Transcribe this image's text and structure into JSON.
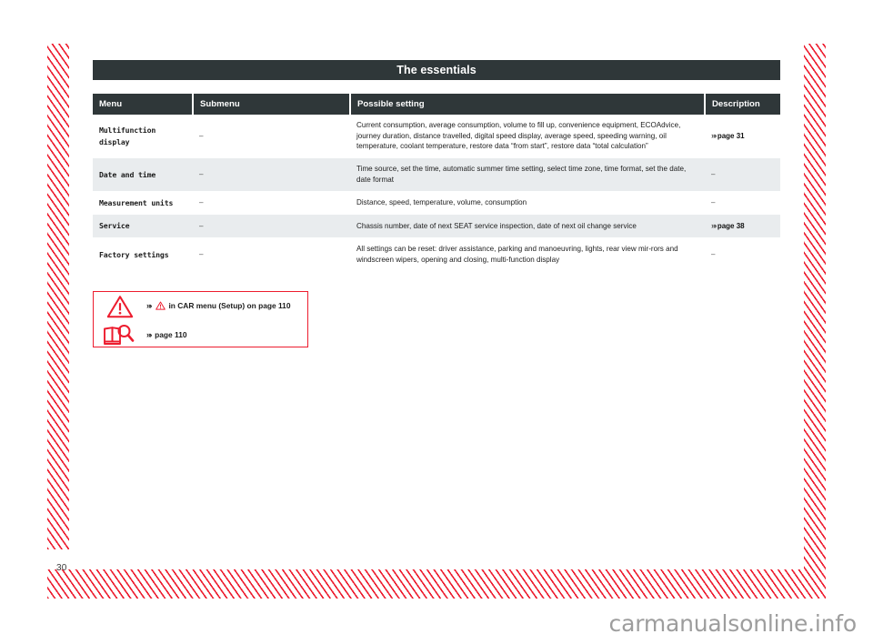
{
  "document": {
    "chapter_title": "The essentials",
    "page_number": "30",
    "watermark": "carmanualsonline.info"
  },
  "table": {
    "columns": [
      "Menu",
      "Submenu",
      "Possible setting",
      "Description"
    ],
    "rows": [
      {
        "menu": "Multifunction display",
        "submenu": "–",
        "setting": "Current consumption, average consumption, volume to fill up, convenience equipment, ECOAdvice, journey duration, distance travelled, digital speed display, average speed, speeding warning, oil temperature, coolant temperature, restore data “from start”, restore data “total calculation”",
        "description": "page 31",
        "description_has_ref": true
      },
      {
        "menu": "Date and time",
        "submenu": "–",
        "setting": "Time source, set the time, automatic summer time setting, select time zone, time format, set the date, date format",
        "description": "–",
        "description_has_ref": false
      },
      {
        "menu": "Measurement units",
        "submenu": "–",
        "setting": "Distance, speed, temperature, volume, consumption",
        "description": "–",
        "description_has_ref": false
      },
      {
        "menu": "Service",
        "submenu": "–",
        "setting": "Chassis number, date of next SEAT service inspection, date of next oil change service",
        "description": "page 38",
        "description_has_ref": true
      },
      {
        "menu": "Factory settings",
        "submenu": "–",
        "setting": "All settings can be reset: driver assistance, parking and manoeuvring, lights, rear view mir-rors and windscreen wipers, opening and closing, multi-function display",
        "description": "–",
        "description_has_ref": false
      }
    ]
  },
  "legend": {
    "warning_row": {
      "icon": "warning-triangle-icon",
      "text_before": "in CAR menu (Setup) on page 110"
    },
    "reference_row": {
      "icon": "book-magnifier-icon",
      "text": "page 110"
    }
  },
  "colors": {
    "brand_red": "#ed1c2e",
    "header_dark": "#2f3739",
    "row_alt": "#e9ecee"
  }
}
